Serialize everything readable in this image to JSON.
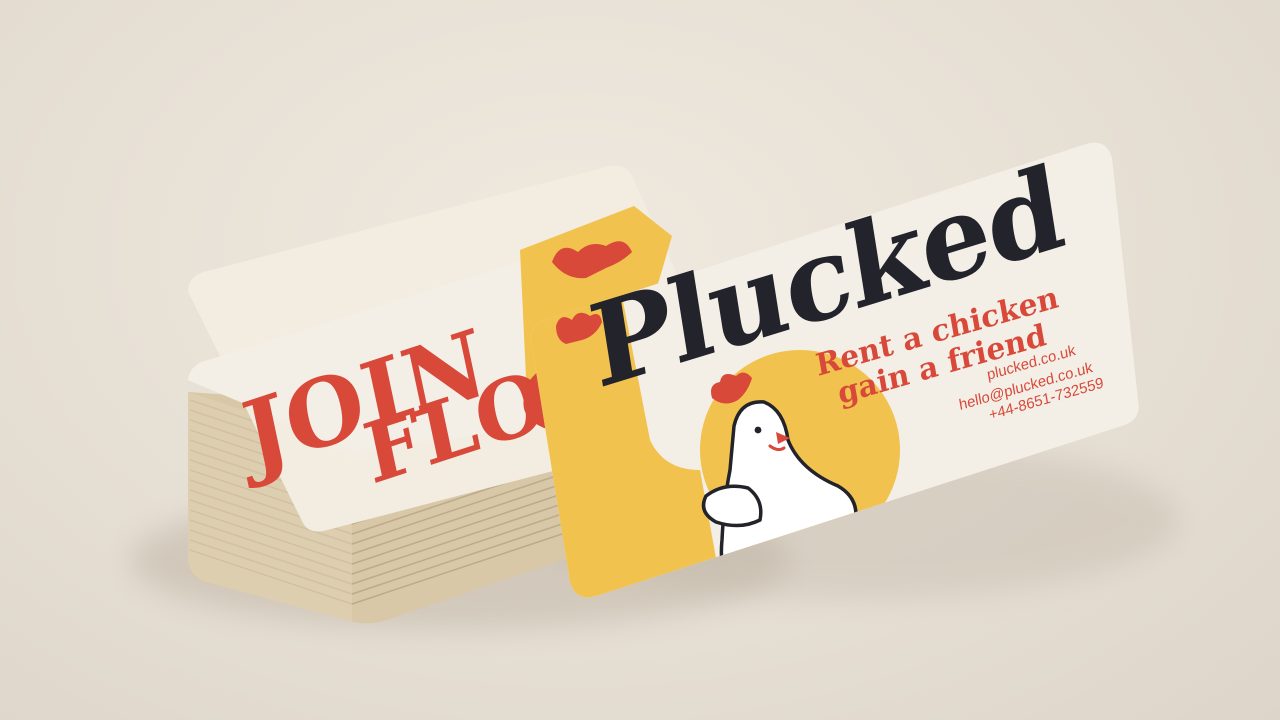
{
  "colors": {
    "background": "#e8e2d8",
    "card_cream": "#f4efe6",
    "accent_red": "#d8493a",
    "accent_yellow": "#f2c24e",
    "ink_dark": "#23232b"
  },
  "back_card": {
    "headline_line1": "JOIN",
    "headline_line2": "FLO"
  },
  "front_card": {
    "logo": "Plucked",
    "tagline_line1": "Rent a chicken",
    "tagline_line2": "gain a friend",
    "website": "plucked.co.uk",
    "email": "hello@plucked.co.uk",
    "phone": "+44-8651-732559"
  },
  "icons": {
    "mascot": "chicken-mascot-illustration",
    "comb": "chicken-comb-icon"
  }
}
